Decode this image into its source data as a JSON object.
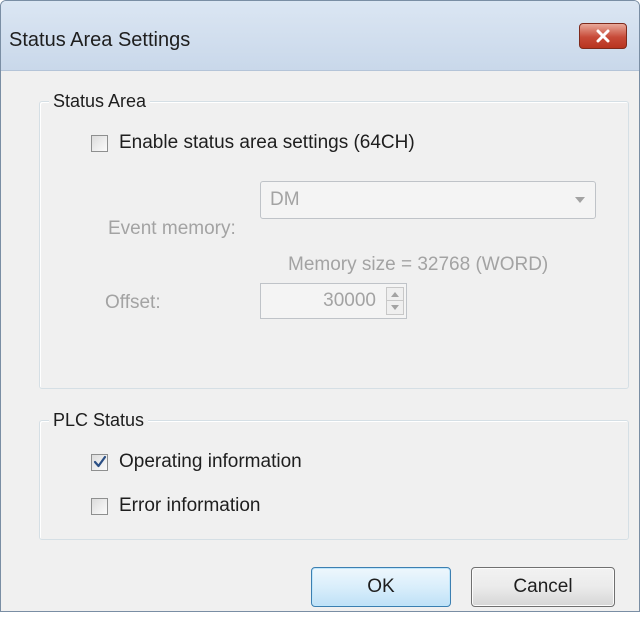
{
  "dialog": {
    "title": "Status Area Settings",
    "close_icon": "close-x-icon"
  },
  "status_area": {
    "group_label": "Status Area",
    "enable_checkbox": {
      "label": "Enable status area settings (64CH)",
      "checked": false
    },
    "event_memory": {
      "label": "Event memory:",
      "value": "DM",
      "enabled": false
    },
    "memory_size_text": "Memory size = 32768 (WORD)",
    "offset": {
      "label": "Offset:",
      "value": "30000",
      "enabled": false
    }
  },
  "plc_status": {
    "group_label": "PLC Status",
    "operating_information": {
      "label": "Operating information",
      "checked": true
    },
    "error_information": {
      "label": "Error information",
      "checked": false
    }
  },
  "buttons": {
    "ok_label": "OK",
    "cancel_label": "Cancel"
  },
  "colors": {
    "title_bar": "#c9d8ea",
    "close_button": "#c74a38",
    "disabled_text": "#a3a3a3",
    "ok_button_border": "#3c7fb1"
  }
}
